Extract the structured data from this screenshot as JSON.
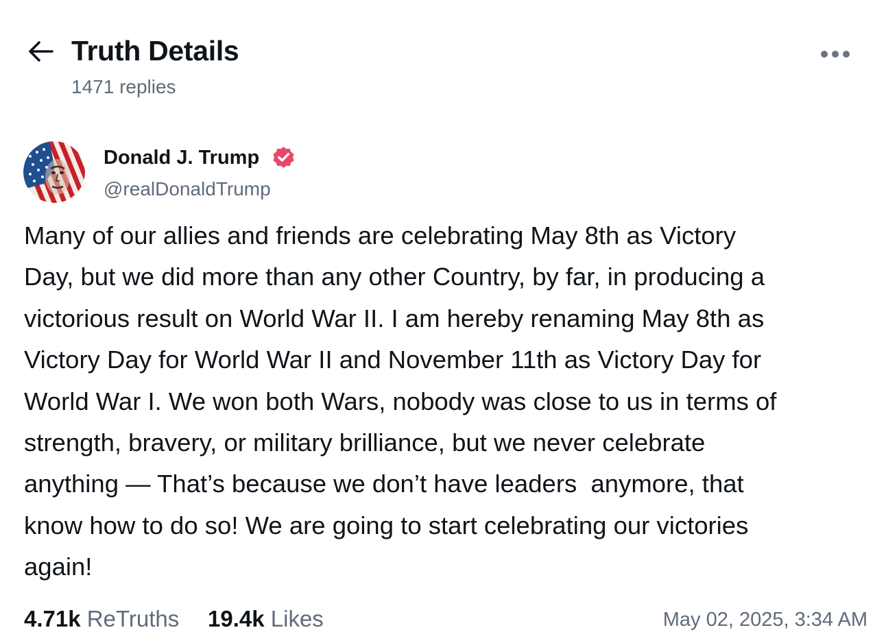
{
  "header": {
    "title": "Truth Details",
    "reply_count": "1471 replies",
    "back_icon": "arrow-left-icon",
    "more_icon": "more-horizontal-icon"
  },
  "author": {
    "name": "Donald J. Trump",
    "handle": "@realDonaldTrump",
    "verified": true,
    "verified_color": "#e8476a"
  },
  "post": {
    "lines": [
      "Many of our allies and friends are celebrating May 8th as Victory",
      "Day, but we did more than any other Country, by far, in producing a",
      "victorious result on World War II. I am hereby renaming May 8th as",
      "Victory Day for World War II and November 11th as Victory Day for",
      "World War I. We won both Wars, nobody was close to us in terms of",
      "strength, bravery, or military brilliance, but we never celebrate",
      "anything — That’s because we don’t have leaders  anymore, that",
      "know how to do so! We are going to start celebrating our victories",
      "again!"
    ]
  },
  "stats": {
    "retruths_count": "4.71k",
    "retruths_label": "ReTruths",
    "likes_count": "19.4k",
    "likes_label": "Likes",
    "timestamp": "May 02, 2025, 3:34 AM"
  },
  "colors": {
    "text_primary": "#0f1419",
    "text_secondary": "#5f6b7a",
    "background": "#ffffff"
  }
}
